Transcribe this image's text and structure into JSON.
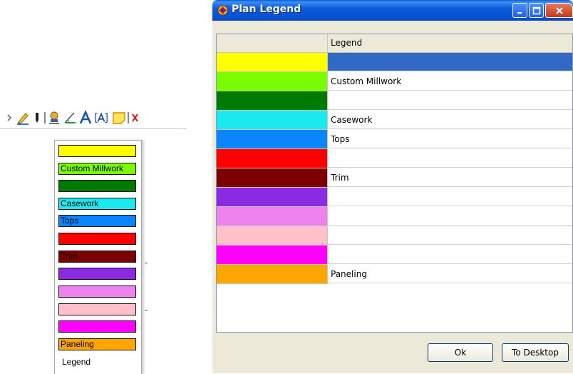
{
  "toolbar": {
    "icons": [
      "arrow-icon",
      "pencil-icon",
      "marker-icon",
      "stamp-icon",
      "angle-icon",
      "text-icon",
      "text-box-icon",
      "sticky-note-icon",
      "close-icon"
    ]
  },
  "dropdown": {
    "items": [
      {
        "label": "",
        "color": "#ffff00"
      },
      {
        "label": "Custom Millwork",
        "color": "#7cfc00"
      },
      {
        "label": "",
        "color": "#007a00"
      },
      {
        "label": "Casework",
        "color": "#1ae9f0"
      },
      {
        "label": "Tops",
        "color": "#0a84ff"
      },
      {
        "label": "",
        "color": "#ff0000"
      },
      {
        "label": "Trim",
        "color": "#7d0000"
      },
      {
        "label": "",
        "color": "#8a2be2"
      },
      {
        "label": "",
        "color": "#ee82ee"
      },
      {
        "label": "",
        "color": "#ffc0cb"
      },
      {
        "label": "",
        "color": "#ff00ff"
      },
      {
        "label": "Paneling",
        "color": "#ffa500"
      }
    ],
    "footer_label": "Legend"
  },
  "dialog": {
    "title": "Plan Legend",
    "column_header": "Legend",
    "rows": [
      {
        "color": "#ffff00",
        "label": "",
        "selected": true
      },
      {
        "color": "#7cfc00",
        "label": "Custom Millwork"
      },
      {
        "color": "#007a00",
        "label": ""
      },
      {
        "color": "#1ae9f0",
        "label": "Casework"
      },
      {
        "color": "#0a84ff",
        "label": "Tops"
      },
      {
        "color": "#ff0000",
        "label": ""
      },
      {
        "color": "#7d0000",
        "label": "Trim"
      },
      {
        "color": "#8a2be2",
        "label": ""
      },
      {
        "color": "#ee82ee",
        "label": ""
      },
      {
        "color": "#ffc0cb",
        "label": ""
      },
      {
        "color": "#ff00ff",
        "label": ""
      },
      {
        "color": "#ffa500",
        "label": "Paneling"
      }
    ],
    "ok_label": "Ok",
    "to_desktop_label": "To Desktop"
  },
  "colors": {
    "titlebar": "#0654d2",
    "selection": "#316ac5",
    "dialog_bg": "#ece9d8"
  }
}
